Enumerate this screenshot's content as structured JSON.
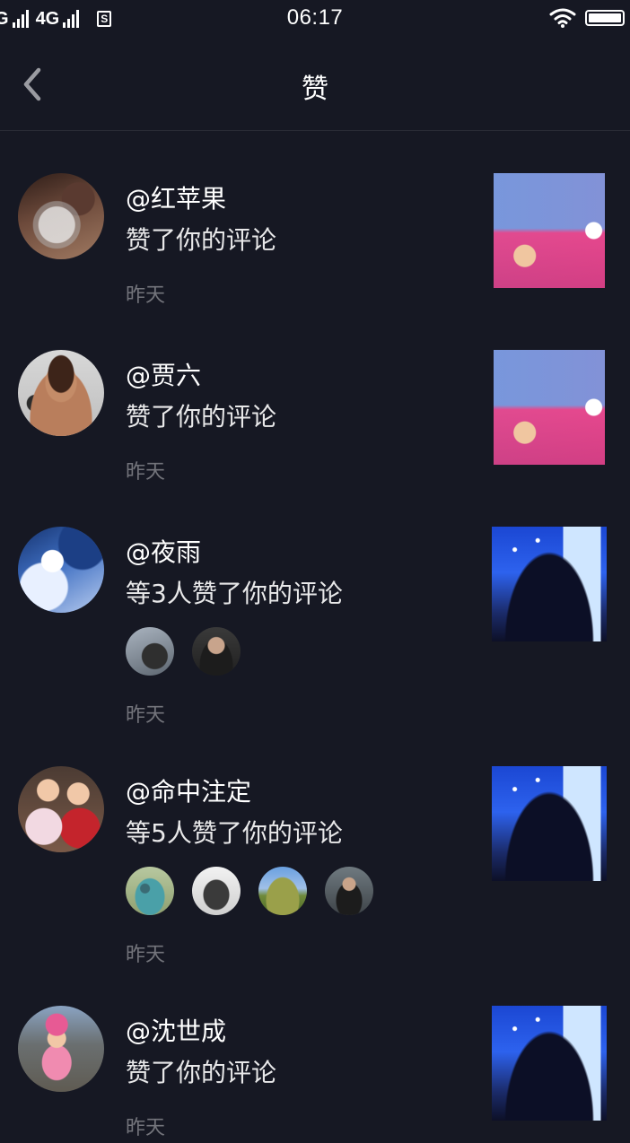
{
  "status_bar": {
    "carrier": "G",
    "network": "4G",
    "app_icon_letter": "S",
    "time": "06:17"
  },
  "nav": {
    "title": "赞"
  },
  "likes": [
    {
      "username": "@红苹果",
      "action": "赞了你的评论",
      "time": "昨天"
    },
    {
      "username": "@贾六",
      "action": "赞了你的评论",
      "time": "昨天"
    },
    {
      "username": "@夜雨",
      "action": "等3人赞了你的评论",
      "time": "昨天"
    },
    {
      "username": "@命中注定",
      "action": "等5人赞了你的评论",
      "time": "昨天"
    },
    {
      "username": "@沈世成",
      "action": "赞了你的评论",
      "time": "昨天"
    }
  ]
}
